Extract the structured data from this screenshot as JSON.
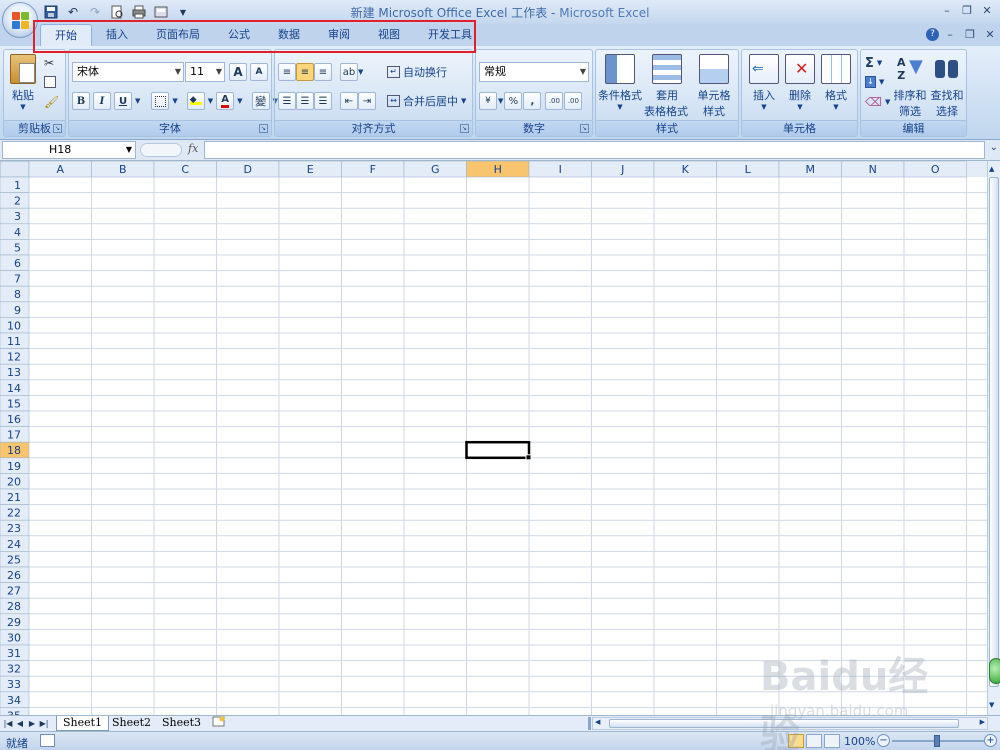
{
  "window": {
    "title_prefix": "新建 Microsoft Office Excel 工作表 - ",
    "title_app": "Microsoft Excel"
  },
  "qat": {
    "icons": [
      "save-icon",
      "undo-icon",
      "redo-icon",
      "print-preview-icon",
      "quick-print-icon",
      "customize-icon"
    ]
  },
  "tabs": [
    {
      "label": "开始",
      "active": true
    },
    {
      "label": "插入"
    },
    {
      "label": "页面布局"
    },
    {
      "label": "公式"
    },
    {
      "label": "数据"
    },
    {
      "label": "审阅"
    },
    {
      "label": "视图"
    },
    {
      "label": "开发工具"
    }
  ],
  "ribbon": {
    "clipboard": {
      "label": "剪贴板",
      "paste": "粘贴"
    },
    "font": {
      "label": "字体",
      "name": "宋体",
      "size": "11",
      "bold": "B",
      "italic": "I",
      "underline": "U",
      "font_color_glyph": "A",
      "increase_glyph": "A",
      "decrease_glyph": "A",
      "phonetic_glyph": "變"
    },
    "alignment": {
      "label": "对齐方式",
      "wrap": "自动换行",
      "merge": "合并后居中"
    },
    "number": {
      "label": "数字",
      "format": "常规",
      "percent": "%",
      "comma": ",",
      "inc_decimal": ".00",
      "dec_decimal": ".00"
    },
    "styles": {
      "label": "样式",
      "conditional": "条件格式",
      "table_line1": "套用",
      "table_line2": "表格格式",
      "cell_line1": "单元格",
      "cell_line2": "样式"
    },
    "cells": {
      "label": "单元格",
      "insert": "插入",
      "delete": "删除",
      "format": "格式"
    },
    "editing": {
      "label": "编辑",
      "sum_glyph": "Σ",
      "sort_line1": "排序和",
      "sort_line2": "筛选",
      "find_line1": "查找和",
      "find_line2": "选择"
    }
  },
  "formula_bar": {
    "name_box": "H18",
    "fx": "fx",
    "value": ""
  },
  "grid": {
    "columns": [
      "A",
      "B",
      "C",
      "D",
      "E",
      "F",
      "G",
      "H",
      "I",
      "J",
      "K",
      "L",
      "M",
      "N",
      "O"
    ],
    "selected_column": "H",
    "selected_row": 18,
    "row_count": 35
  },
  "sheets": [
    {
      "label": "Sheet1",
      "active": true
    },
    {
      "label": "Sheet2"
    },
    {
      "label": "Sheet3"
    }
  ],
  "status": {
    "text": "就绪",
    "zoom": "100%"
  },
  "colors": {
    "accent": "#15428b",
    "selected_header": "#f9c46e",
    "highlight_box": "#e0202a",
    "ribbon_bg": "#c9dcf1"
  },
  "watermark": {
    "logo": "Baidu经验",
    "url": "jingyan.baidu.com"
  }
}
